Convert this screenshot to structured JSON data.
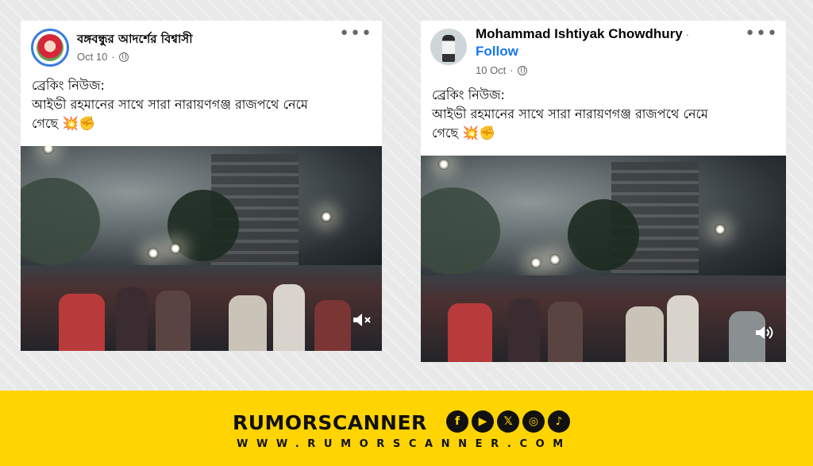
{
  "posts": [
    {
      "author": "বঙ্গবন্ধুর আদর্শের বিশ্বাসী",
      "date": "Oct 10",
      "text_line1": "ব্রেকিং নিউজ:",
      "text_line2": "আইভী রহমানের সাথে সারা নারায়ণগঞ্জ রাজপথে নেমে",
      "text_line3": "গেছে",
      "emojis": "💥✊",
      "sound_state": "muted"
    },
    {
      "author": "Mohammad Ishtiyak Chowdhury",
      "separator": "·",
      "follow_label": "Follow",
      "date": "10 Oct",
      "text_line1": "ব্রেকিং নিউজ:",
      "text_line2": "আইভী রহমানের সাথে সারা নারায়ণগঞ্জ রাজপথে নেমে",
      "text_line3": "গেছে",
      "emojis": "💥✊",
      "sound_state": "on"
    }
  ],
  "more_label": "•••",
  "footer": {
    "brand": "RUMORSCANNER",
    "url": "WWW.RUMORSCANNER.COM",
    "socials": [
      {
        "icon": "facebook-icon",
        "glyph": "f"
      },
      {
        "icon": "youtube-icon",
        "glyph": "▶"
      },
      {
        "icon": "x-icon",
        "glyph": "𝕏"
      },
      {
        "icon": "instagram-icon",
        "glyph": "◎"
      },
      {
        "icon": "tiktok-icon",
        "glyph": "♪"
      }
    ],
    "accent_color": "#ffd400"
  }
}
